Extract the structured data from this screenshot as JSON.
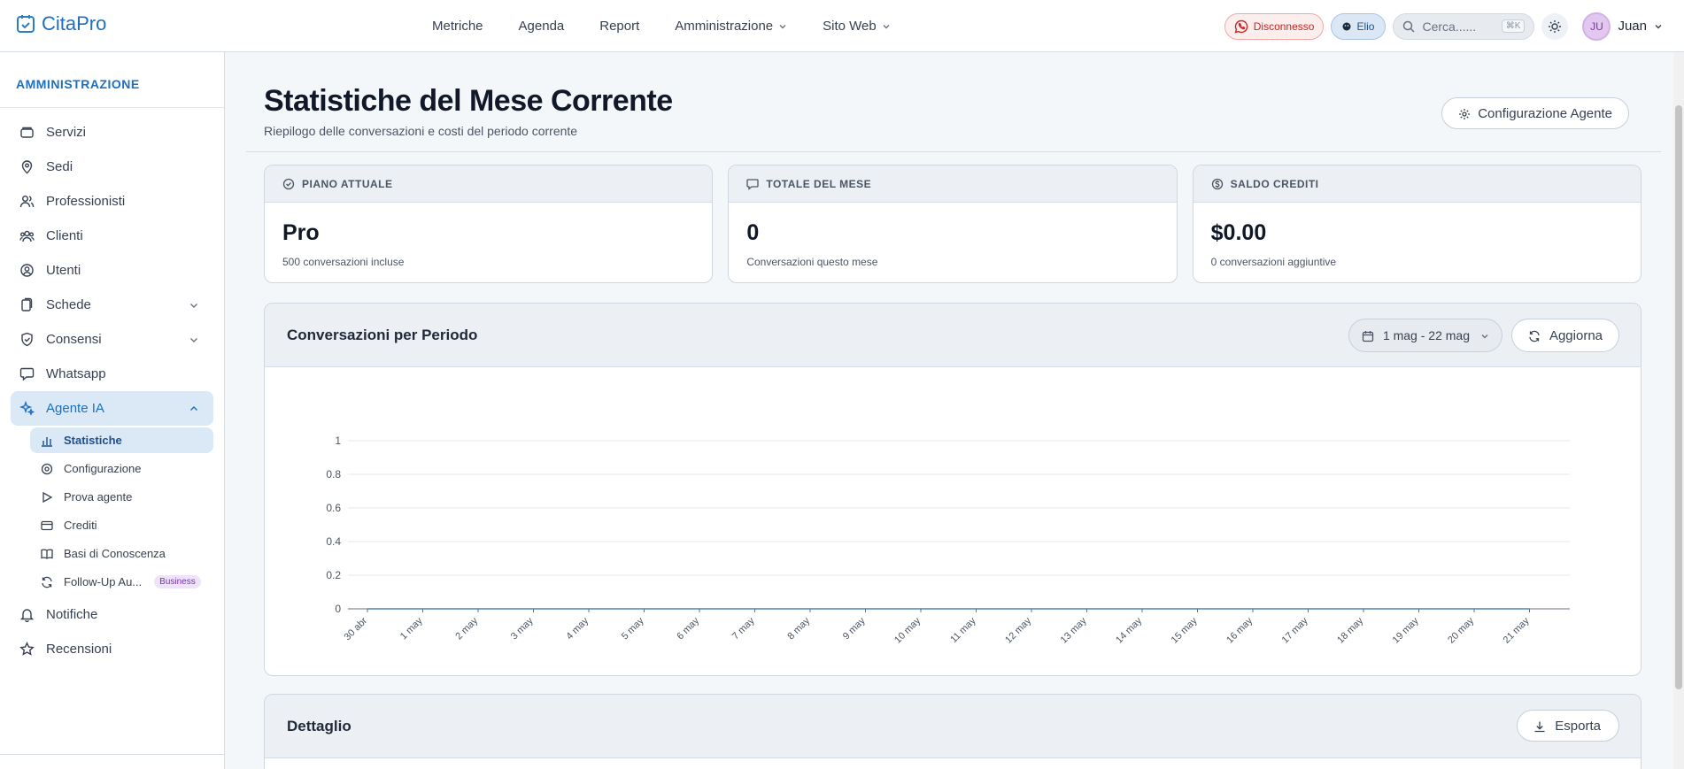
{
  "app": {
    "logo_text": "CitaPro"
  },
  "nav": {
    "items": [
      {
        "label": "Metriche"
      },
      {
        "label": "Agenda"
      },
      {
        "label": "Report"
      },
      {
        "label": "Amministrazione"
      },
      {
        "label": "Sito Web"
      }
    ]
  },
  "header_right": {
    "whatsapp_status": "Disconnesso",
    "workspace": "Elio",
    "search_placeholder": "Cerca......",
    "search_shortcut": "⌘K",
    "user_initials": "JU",
    "user_name": "Juan"
  },
  "sidebar": {
    "title": "AMMINISTRAZIONE",
    "items": [
      {
        "label": "Servizi",
        "icon": "box-icon"
      },
      {
        "label": "Sedi",
        "icon": "map-pin-icon"
      },
      {
        "label": "Professionisti",
        "icon": "users-icon"
      },
      {
        "label": "Clienti",
        "icon": "users-group-icon"
      },
      {
        "label": "Utenti",
        "icon": "user-cog-icon"
      },
      {
        "label": "Schede",
        "icon": "clipboard-icon"
      },
      {
        "label": "Consensi",
        "icon": "shield-icon"
      },
      {
        "label": "Whatsapp",
        "icon": "chat-icon"
      },
      {
        "label": "Agente IA",
        "icon": "sparkles-icon"
      },
      {
        "label": "Notifiche",
        "icon": "bell-icon"
      },
      {
        "label": "Recensioni",
        "icon": "star-icon"
      }
    ],
    "sub_items": [
      {
        "label": "Statistiche"
      },
      {
        "label": "Configurazione"
      },
      {
        "label": "Prova agente"
      },
      {
        "label": "Crediti"
      },
      {
        "label": "Basi di Conoscenza"
      },
      {
        "label": "Follow-Up Au...",
        "badge": "Business"
      }
    ]
  },
  "main": {
    "title": "Statistiche del Mese Corrente",
    "subtitle": "Riepilogo delle conversazioni e costi del periodo corrente",
    "config_button": "Configurazione Agente",
    "cards": [
      {
        "header": "PIANO ATTUALE",
        "value": "Pro",
        "sub": "500 conversazioni incluse"
      },
      {
        "header": "TOTALE DEL MESE",
        "value": "0",
        "sub": "Conversazioni questo mese"
      },
      {
        "header": "SALDO CREDITI",
        "value": "$0.00",
        "sub": "0 conversazioni aggiuntive"
      }
    ],
    "chart_panel": {
      "title": "Conversazioni per Periodo",
      "date_range": "1 mag - 22 mag",
      "refresh_button": "Aggiorna"
    },
    "detail_panel": {
      "title": "Dettaglio",
      "export_button": "Esporta"
    }
  },
  "colors": {
    "accent": "#1d6fbf",
    "active_bg": "#dbe8f6",
    "disconnected": "#c42727",
    "badge": "#7b2fb5"
  },
  "chart_data": {
    "type": "line",
    "categories": [
      "30 abr",
      "1 may",
      "2 may",
      "3 may",
      "4 may",
      "5 may",
      "6 may",
      "7 may",
      "8 may",
      "9 may",
      "10 may",
      "11 may",
      "12 may",
      "13 may",
      "14 may",
      "15 may",
      "16 may",
      "17 may",
      "18 may",
      "19 may",
      "20 may",
      "21 may"
    ],
    "values": [
      0,
      0,
      0,
      0,
      0,
      0,
      0,
      0,
      0,
      0,
      0,
      0,
      0,
      0,
      0,
      0,
      0,
      0,
      0,
      0,
      0,
      0
    ],
    "y_ticks": [
      "0",
      "0.2",
      "0.4",
      "0.6",
      "0.8",
      "1"
    ],
    "ylim": [
      0,
      1
    ],
    "grid": true
  }
}
